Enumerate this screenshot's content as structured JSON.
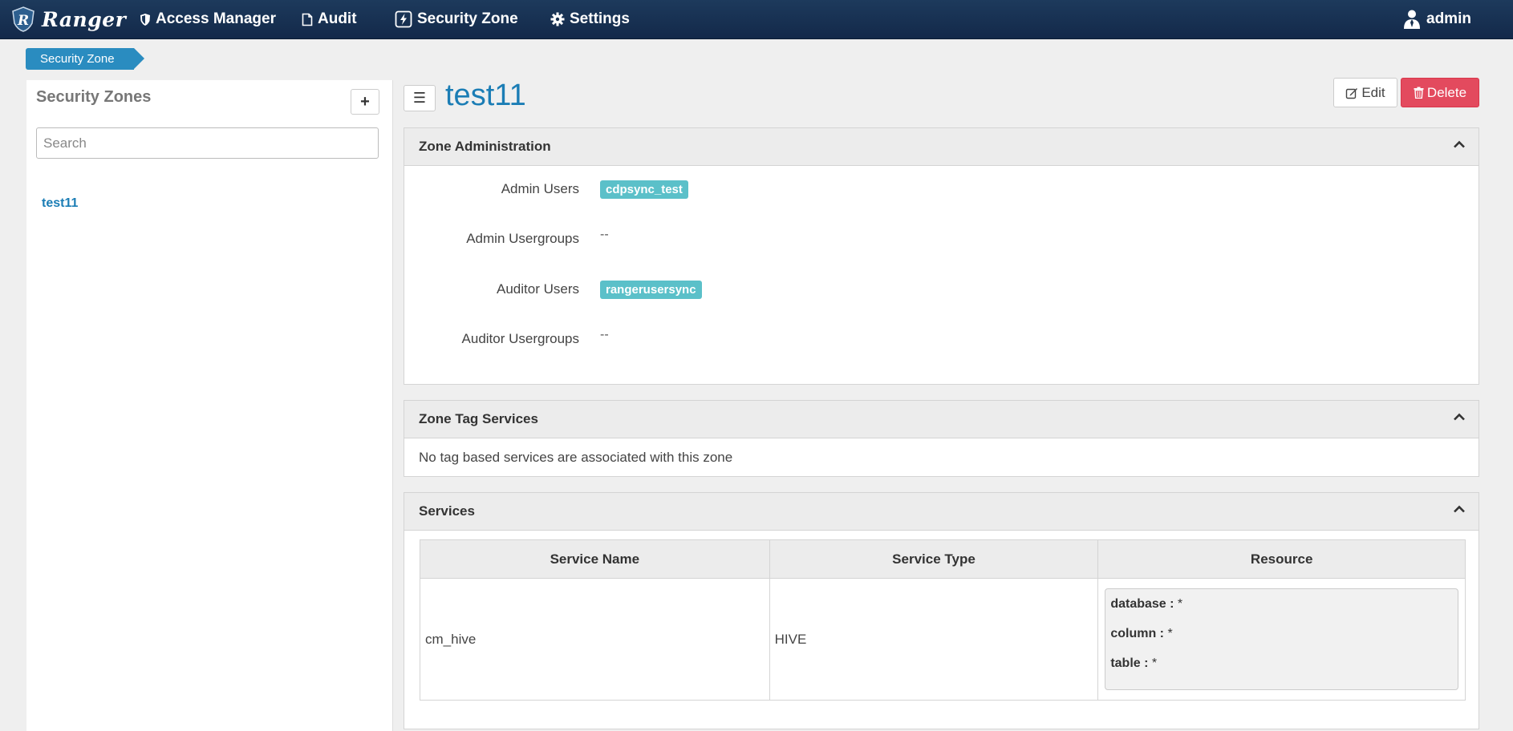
{
  "nav": {
    "brand": "Ranger",
    "items": [
      {
        "label": "Access Manager",
        "icon": "shield-icon"
      },
      {
        "label": "Audit",
        "icon": "file-icon"
      },
      {
        "label": "Security Zone",
        "icon": "bolt-icon"
      },
      {
        "label": "Settings",
        "icon": "gear-icon"
      }
    ],
    "user": "admin"
  },
  "breadcrumb": "Security Zone",
  "sidebar": {
    "title": "Security Zones",
    "search_placeholder": "Search",
    "zones": [
      "test11"
    ]
  },
  "zone": {
    "name": "test11",
    "edit_label": "Edit",
    "delete_label": "Delete"
  },
  "zone_admin": {
    "title": "Zone Administration",
    "admin_users_label": "Admin Users",
    "admin_users": [
      "cdpsync_test"
    ],
    "admin_usergroups_label": "Admin Usergroups",
    "admin_usergroups": "--",
    "auditor_users_label": "Auditor Users",
    "auditor_users": [
      "rangerusersync"
    ],
    "auditor_usergroups_label": "Auditor Usergroups",
    "auditor_usergroups": "--"
  },
  "tag_services": {
    "title": "Zone Tag Services",
    "empty_text": "No tag based services are associated with this zone"
  },
  "services": {
    "title": "Services",
    "columns": [
      "Service Name",
      "Service Type",
      "Resource"
    ],
    "rows": [
      {
        "name": "cm_hive",
        "type": "HIVE",
        "resources": [
          {
            "key": "database :",
            "value": "*"
          },
          {
            "key": "column :",
            "value": "*"
          },
          {
            "key": "table :",
            "value": "*"
          }
        ]
      }
    ]
  }
}
